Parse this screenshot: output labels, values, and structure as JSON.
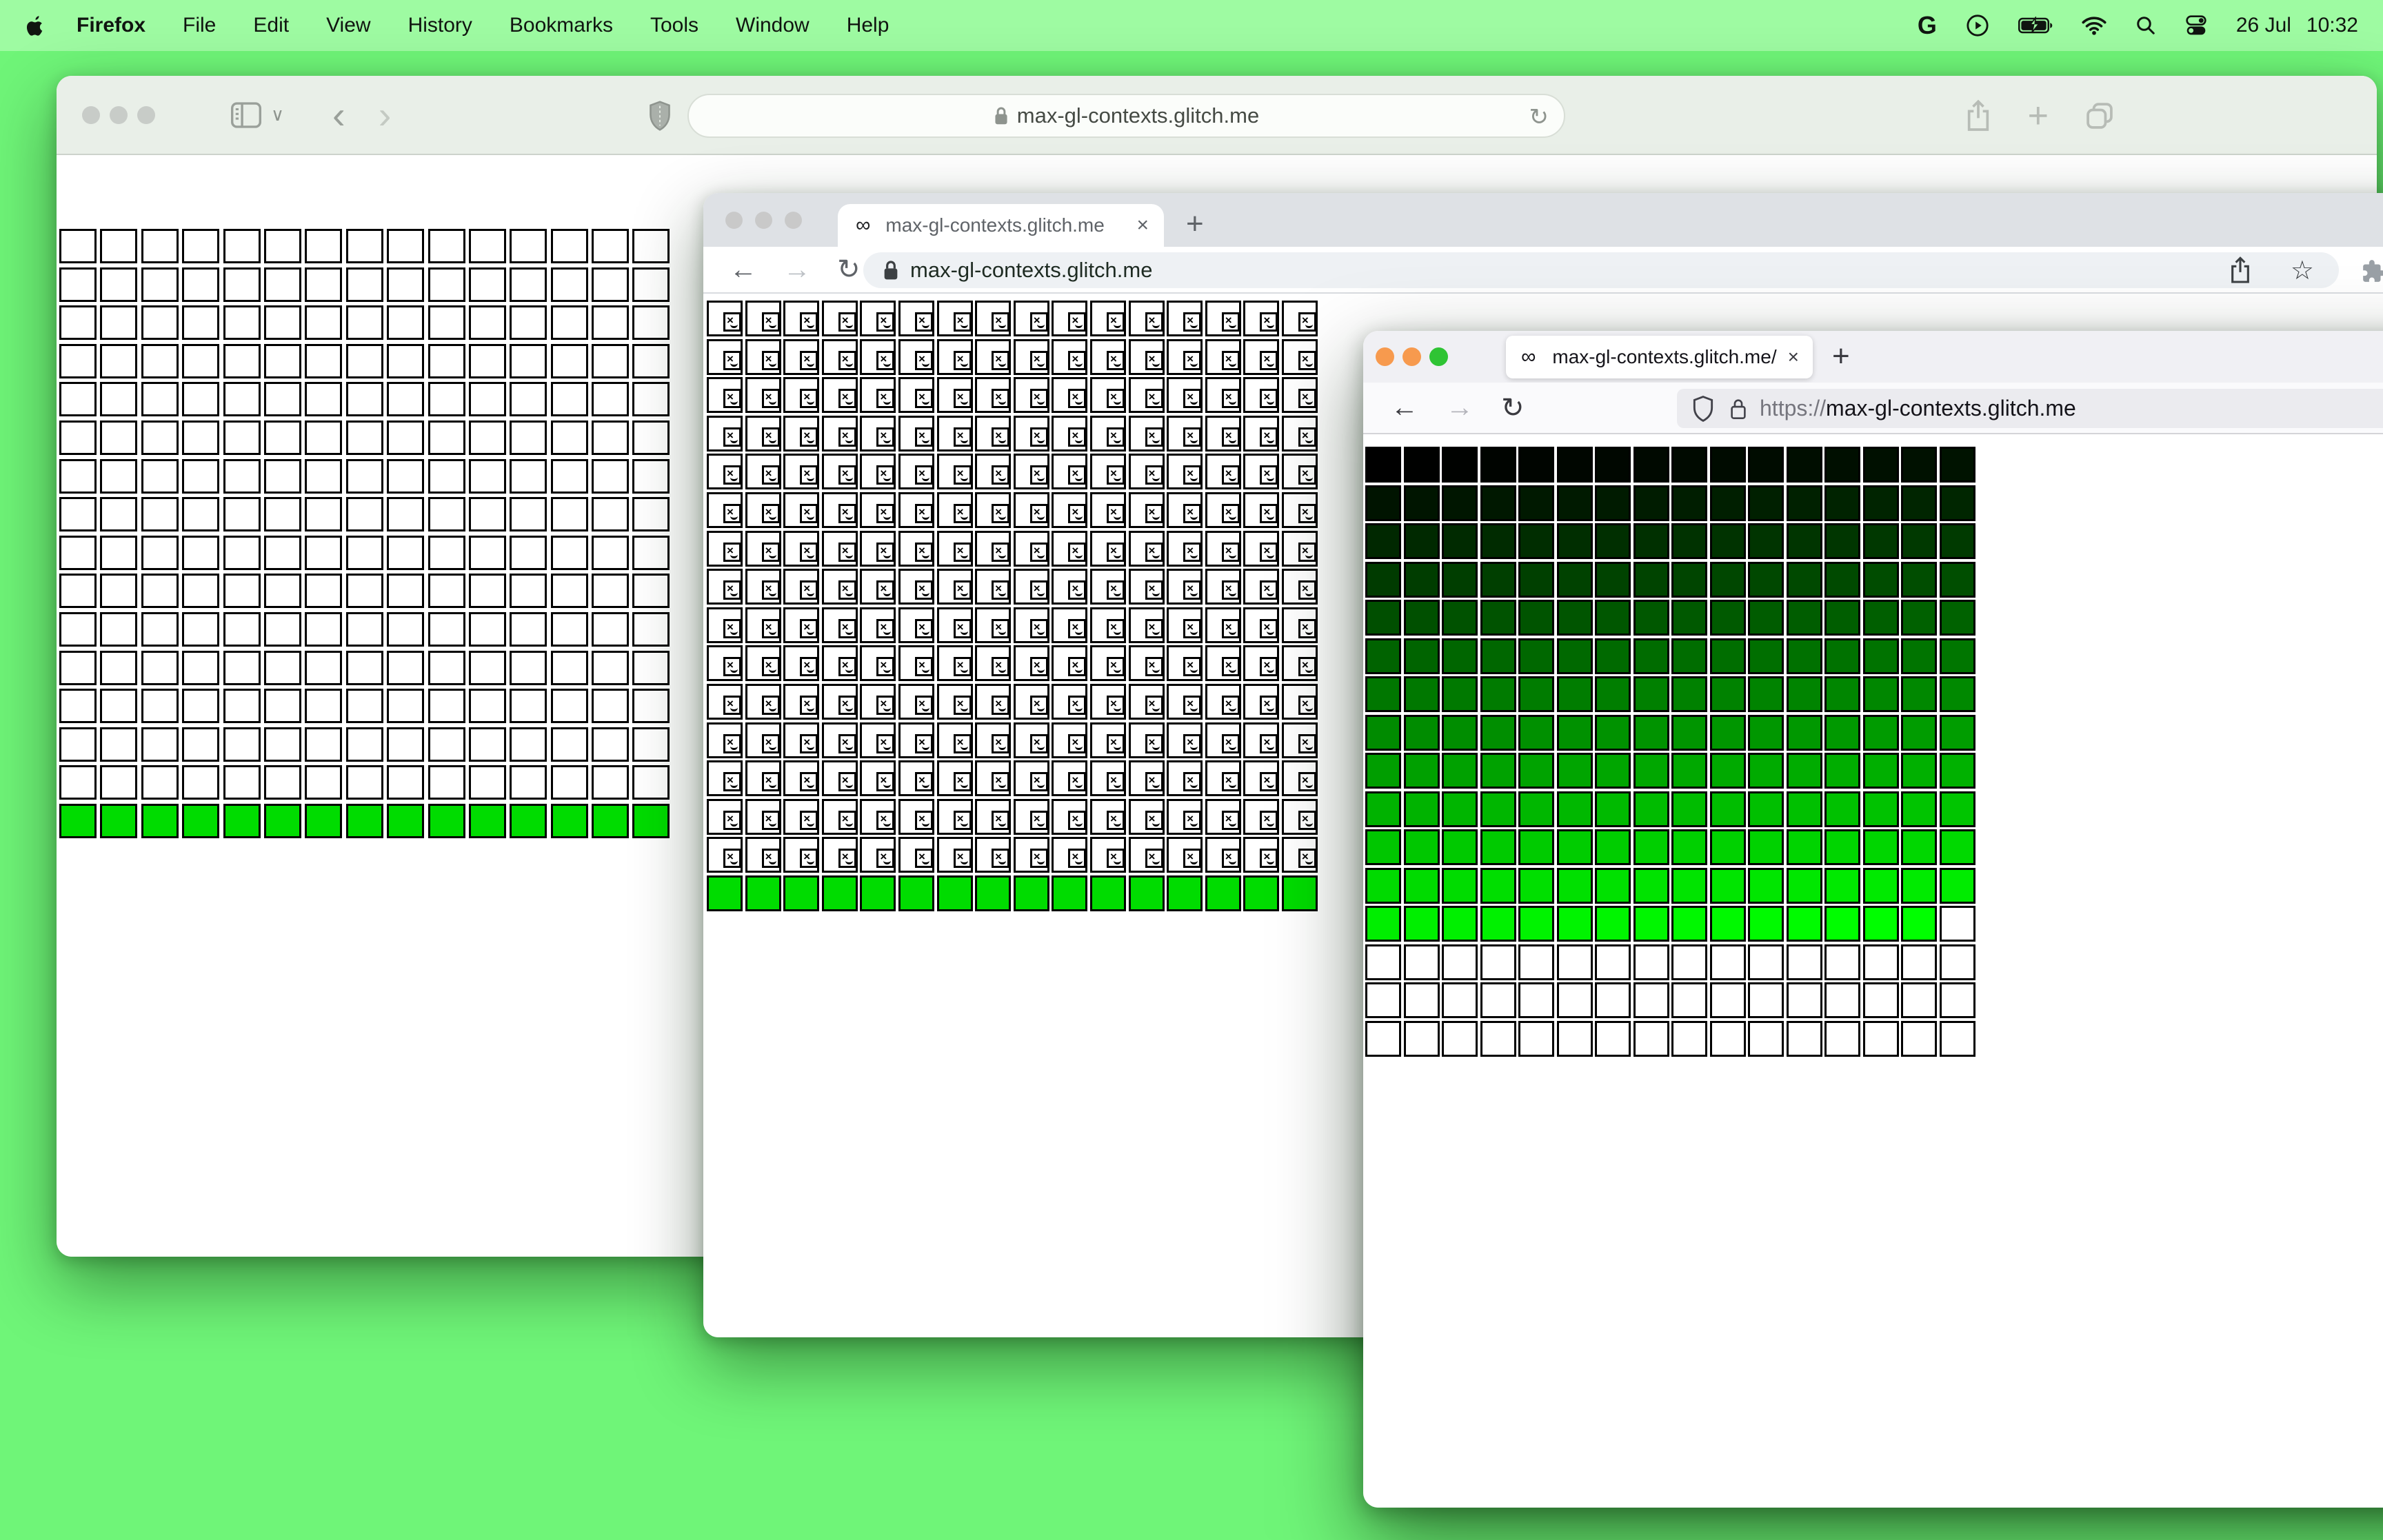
{
  "menu_bar": {
    "items": [
      "Firefox",
      "File",
      "Edit",
      "View",
      "History",
      "Bookmarks",
      "Tools",
      "Window",
      "Help"
    ],
    "date": "26 Jul",
    "time": "10:32"
  },
  "icons": {
    "infinity": "∞",
    "close": "×",
    "plus": "+",
    "back_arrow": "←",
    "forward_arrow": "→",
    "reload": "↻",
    "back_chevron": "‹",
    "forward_chevron": "›",
    "chevron_down": "∨",
    "star": "☆",
    "google_g": "G"
  },
  "safari": {
    "url": "max-gl-contexts.glitch.me",
    "traffic_lights": [
      "#c8ccc8",
      "#c8ccc8",
      "#c8ccc8"
    ]
  },
  "chrome": {
    "tab_title": "max-gl-contexts.glitch.me",
    "url": "max-gl-contexts.glitch.me",
    "traffic_lights": [
      "#c9c9c9",
      "#c9c9c9",
      "#c9c9c9"
    ]
  },
  "firefox": {
    "tab_title": "max-gl-contexts.glitch.me/",
    "url_scheme": "https://",
    "url_host": "max-gl-contexts.glitch.me",
    "traffic_lights": [
      "#f79a4e",
      "#f79a4e",
      "#2fc434"
    ]
  },
  "grids": {
    "safari": {
      "type": "blank",
      "cols": 15,
      "rows": 16
    },
    "chrome": {
      "type": "broken",
      "cols": 16,
      "rows": 16
    },
    "firefox": {
      "type": "gradient",
      "cols": 16,
      "rows": 16,
      "colored_cells": 207
    }
  },
  "colors": {
    "desktop": "#6ff578",
    "menu_bar": "#9efba2",
    "cell_green": "#00dc00",
    "gradient_start": "#000000",
    "gradient_end": "#00ff00"
  }
}
